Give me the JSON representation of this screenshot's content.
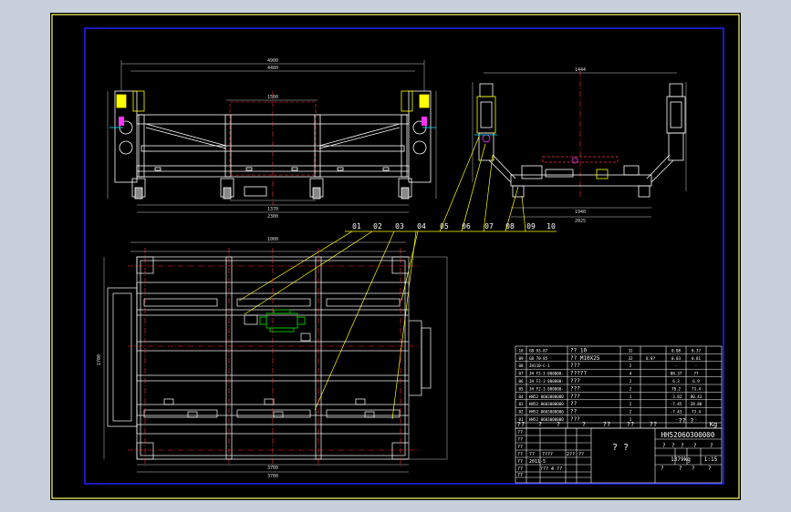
{
  "colors": {
    "background": "#c8d0dc",
    "sheet": "#000000",
    "outer_border": "#ffff66",
    "inner_border": "#2222ff",
    "structure": "#ffffff",
    "centerline": "#ff3333",
    "dimension": "#dddddd",
    "leader": "#ffff00",
    "component": "#00cc00",
    "accent_cyan": "#00e5ff",
    "accent_magenta": "#ff33ff"
  },
  "callouts": [
    "01",
    "02",
    "03",
    "04",
    "05",
    "06",
    "07",
    "08",
    "09",
    "10"
  ],
  "dims": {
    "top_overall": "4900",
    "top_inner": "4480",
    "top_mid": "1500",
    "top_bottom_1": "1370",
    "top_bottom_2": "2300",
    "side_overall": "1444",
    "side_bottom_1": "1940",
    "side_bottom_2": "2025",
    "plan_top": "1000",
    "plan_bottom_1": "3700",
    "plan_bottom_2": "3700",
    "plan_left": "1700"
  },
  "bom": {
    "rows": [
      {
        "no": "10",
        "code": "GB 93-87",
        "name": "?? 10",
        "qty": "32",
        "mat": "",
        "wt": "0.08",
        "total": "0.37"
      },
      {
        "no": "09",
        "code": "GB 70-85",
        "name": "?? M10X25",
        "qty": "32",
        "mat": "8.8?",
        "wt": "0.03",
        "total": "0.81"
      },
      {
        "no": "08",
        "code": "JH110-C-1",
        "name": "???",
        "qty": "2",
        "mat": "",
        "wt": "-",
        "total": "-"
      },
      {
        "no": "07",
        "code": "JH F2-3 000000-",
        "name": "?????",
        "qty": "4",
        "mat": "",
        "wt": "88.37",
        "total": "77"
      },
      {
        "no": "06",
        "code": "JH F2-3 000000-",
        "name": "???",
        "qty": "2",
        "mat": "",
        "wt": "6.3",
        "total": "6.9"
      },
      {
        "no": "05",
        "code": "JH F2-3 000000-",
        "name": "???",
        "qty": "2",
        "mat": "",
        "wt": "78.2",
        "total": "73.4"
      },
      {
        "no": "04",
        "code": "HH52 0603000000",
        "name": "???",
        "qty": "1",
        "mat": "",
        "wt": "-3.82",
        "total": "80.43"
      },
      {
        "no": "03",
        "code": "HH52 0603000000",
        "name": "??",
        "qty": "2",
        "mat": "",
        "wt": "-7.45",
        "total": "28.88"
      },
      {
        "no": "02",
        "code": "HH52 0603000000",
        "name": "??",
        "qty": "2",
        "mat": "",
        "wt": "-7.43",
        "total": "73.4"
      },
      {
        "no": "01",
        "code": "HH52 0603000000",
        "name": "???",
        "qty": "1",
        "mat": "",
        "wt": "-",
        "total": "-"
      }
    ],
    "header": [
      "??",
      "?",
      "?",
      "?",
      "??",
      "??",
      "??",
      "??"
    ],
    "header_right": "?? ?",
    "header_far": "Kg"
  },
  "title_block": {
    "name": "? ?",
    "drawing_no": "HH52060300000",
    "labels_row": [
      "?",
      "?",
      "?",
      "?",
      "?"
    ],
    "sheet_label": "?",
    "scale_label": "?",
    "weight": "1379kg",
    "scale": "1:15",
    "sheet_row": [
      "?",
      "?",
      "?",
      "?"
    ],
    "left_marks": [
      "??",
      "??",
      "??",
      "??",
      "??",
      "??",
      "??"
    ],
    "left_codes": [
      "??",
      "??",
      "????",
      "2??",
      "??",
      "??",
      "??"
    ],
    "left_dates": [
      "2011-5",
      "??",
      "",
      ""
    ],
    "note": "??? 4 ??"
  }
}
